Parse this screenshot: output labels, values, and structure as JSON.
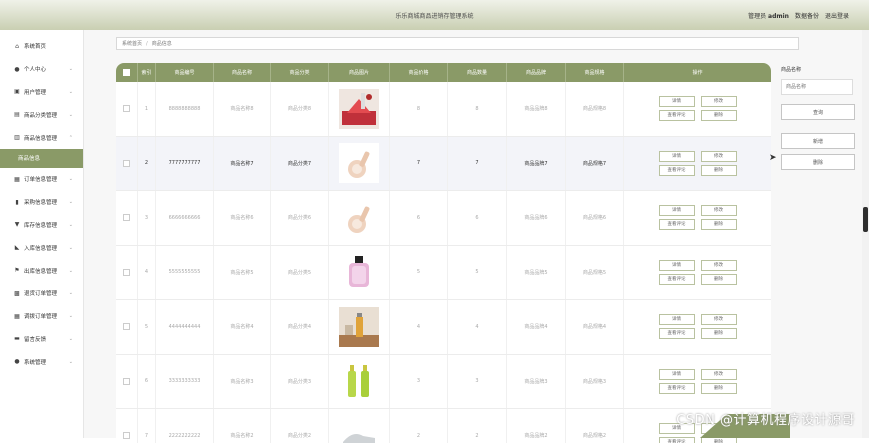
{
  "app": {
    "title": "乐乐商城商品进销存管理系统",
    "admin_role": "管理员",
    "admin_name": "admin",
    "backup": "数据备份",
    "logout": "退出登录"
  },
  "sidebar": {
    "items": [
      {
        "icon": "home-icon",
        "glyph": "⌂",
        "label": "系统首页",
        "arrow": ""
      },
      {
        "icon": "user-icon",
        "glyph": "●",
        "label": "个人中心",
        "arrow": "⌄"
      },
      {
        "icon": "users-icon",
        "glyph": "▣",
        "label": "用户管理",
        "arrow": "⌄"
      },
      {
        "icon": "category-icon",
        "glyph": "▤",
        "label": "商品分类管理",
        "arrow": "⌄"
      },
      {
        "icon": "goods-icon",
        "glyph": "▥",
        "label": "商品信息管理",
        "arrow": "⌃"
      }
    ],
    "active_sub": "商品信息",
    "items2": [
      {
        "icon": "grid-icon",
        "glyph": "▦",
        "label": "订单信息管理",
        "arrow": "⌄"
      },
      {
        "icon": "bars-icon",
        "glyph": "▮",
        "label": "采购信息管理",
        "arrow": "⌄"
      },
      {
        "icon": "shield-icon",
        "glyph": "▼",
        "label": "库存信息管理",
        "arrow": "⌄"
      },
      {
        "icon": "inbound-icon",
        "glyph": "◣",
        "label": "入库信息管理",
        "arrow": "⌄"
      },
      {
        "icon": "flag-icon",
        "glyph": "⚑",
        "label": "出库信息管理",
        "arrow": "⌄"
      },
      {
        "icon": "return-icon",
        "glyph": "▩",
        "label": "退货订单管理",
        "arrow": "⌄"
      },
      {
        "icon": "transfer-icon",
        "glyph": "▦",
        "label": "调拨订单管理",
        "arrow": "⌄"
      },
      {
        "icon": "message-icon",
        "glyph": "▬",
        "label": "留言反馈",
        "arrow": "⌄"
      },
      {
        "icon": "settings-icon",
        "glyph": "●",
        "label": "系统管理",
        "arrow": "⌄"
      }
    ]
  },
  "breadcrumb": {
    "root": "系统首页",
    "current": "商品信息"
  },
  "table": {
    "headers": [
      "索引",
      "商品编号",
      "商品名称",
      "商品分类",
      "商品图片",
      "商品价格",
      "商品数量",
      "商品品牌",
      "商品规格",
      "操作"
    ],
    "rows": [
      {
        "index": "1",
        "code": "8888888888",
        "name": "商品名称8",
        "category": "商品分类8",
        "image": "fruit-photo",
        "price": "8",
        "qty": "8",
        "brand": "商品品牌8",
        "spec": "商品规格8"
      },
      {
        "index": "2",
        "code": "7777777777",
        "name": "商品名称7",
        "category": "商品分类7",
        "image": "citrus-juicer-photo",
        "price": "7",
        "qty": "7",
        "brand": "商品品牌7",
        "spec": "商品规格7"
      },
      {
        "index": "3",
        "code": "6666666666",
        "name": "商品名称6",
        "category": "商品分类6",
        "image": "citrus-juicer-photo",
        "price": "6",
        "qty": "6",
        "brand": "商品品牌6",
        "spec": "商品规格6"
      },
      {
        "index": "4",
        "code": "5555555555",
        "name": "商品名称5",
        "category": "商品分类5",
        "image": "perfume-photo",
        "price": "5",
        "qty": "5",
        "brand": "商品品牌5",
        "spec": "商品规格5"
      },
      {
        "index": "5",
        "code": "4444444444",
        "name": "商品名称4",
        "category": "商品分类4",
        "image": "drink-photo",
        "price": "4",
        "qty": "4",
        "brand": "商品品牌4",
        "spec": "商品规格4"
      },
      {
        "index": "6",
        "code": "3333333333",
        "name": "商品名称3",
        "category": "商品分类3",
        "image": "cosmetics-bottles-photo",
        "price": "3",
        "qty": "3",
        "brand": "商品品牌3",
        "spec": "商品规格3"
      },
      {
        "index": "7",
        "code": "2222222222",
        "name": "商品名称2",
        "category": "商品分类2",
        "image": "shoe-photo",
        "price": "2",
        "qty": "2",
        "brand": "商品品牌2",
        "spec": "商品规格2"
      }
    ],
    "actions": {
      "detail": "详情",
      "edit": "修改",
      "review": "查看评论",
      "delete": "删除"
    }
  },
  "search_panel": {
    "label": "商品名称",
    "placeholder": "商品名称",
    "search": "查询",
    "add": "新增",
    "delete": "删除"
  },
  "watermark": "CSDN @计算机程序设计源哥",
  "colors": {
    "accent": "#8a9a67",
    "header_gradient_top": "#f0f2e9",
    "header_gradient_bottom": "#c9cfb2"
  }
}
